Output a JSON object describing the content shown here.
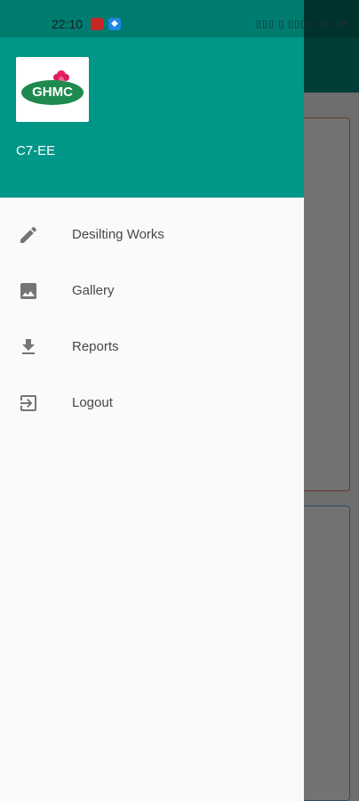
{
  "status_bar": {
    "time": "22:10",
    "right_text": "▯▯▯ ▯ ▯▯▯▯ ▯▯▯▯▾"
  },
  "drawer": {
    "logo_text": "GHMC",
    "user_name": "C7-EE",
    "items": [
      {
        "label": "Desilting Works",
        "icon": "pencil-icon"
      },
      {
        "label": "Gallery",
        "icon": "image-icon"
      },
      {
        "label": "Reports",
        "icon": "download-icon"
      },
      {
        "label": "Logout",
        "icon": "logout-icon"
      }
    ]
  },
  "colors": {
    "header": "#009688",
    "drawer_bg": "#fafafa",
    "icon": "#757575",
    "logo_green": "#1e8a4f"
  }
}
